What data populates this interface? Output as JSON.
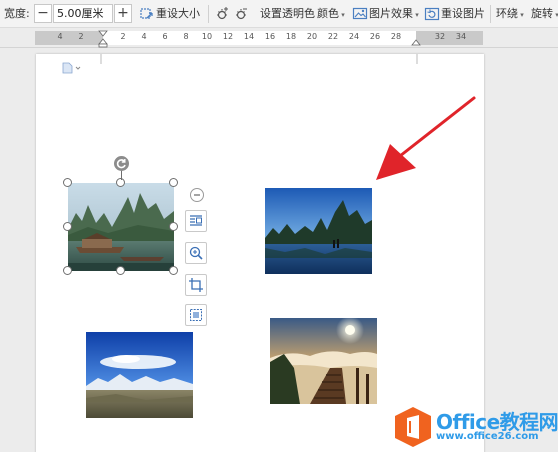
{
  "toolbar": {
    "width_label": "宽度:",
    "minus": "−",
    "width_value": "5.00厘米",
    "plus": "+",
    "reset_size": "重设大小",
    "set_transparent": "设置透明色",
    "color": "颜色",
    "picture_effects": "图片效果",
    "reset_picture": "重设图片",
    "wrap": "环绕",
    "rotate": "旋转"
  },
  "ruler": {
    "numbers": [
      "4",
      "2",
      "2",
      "4",
      "6",
      "8",
      "10",
      "12",
      "14",
      "16",
      "18",
      "20",
      "22",
      "24",
      "26",
      "28",
      "32",
      "34"
    ]
  },
  "watermark": {
    "brand": "Office教程网",
    "url": "www.office26.com"
  },
  "colors": {
    "arrow": "#e0242a",
    "logo_blue": "#2f9be8",
    "logo_orange": "#f0631f"
  }
}
